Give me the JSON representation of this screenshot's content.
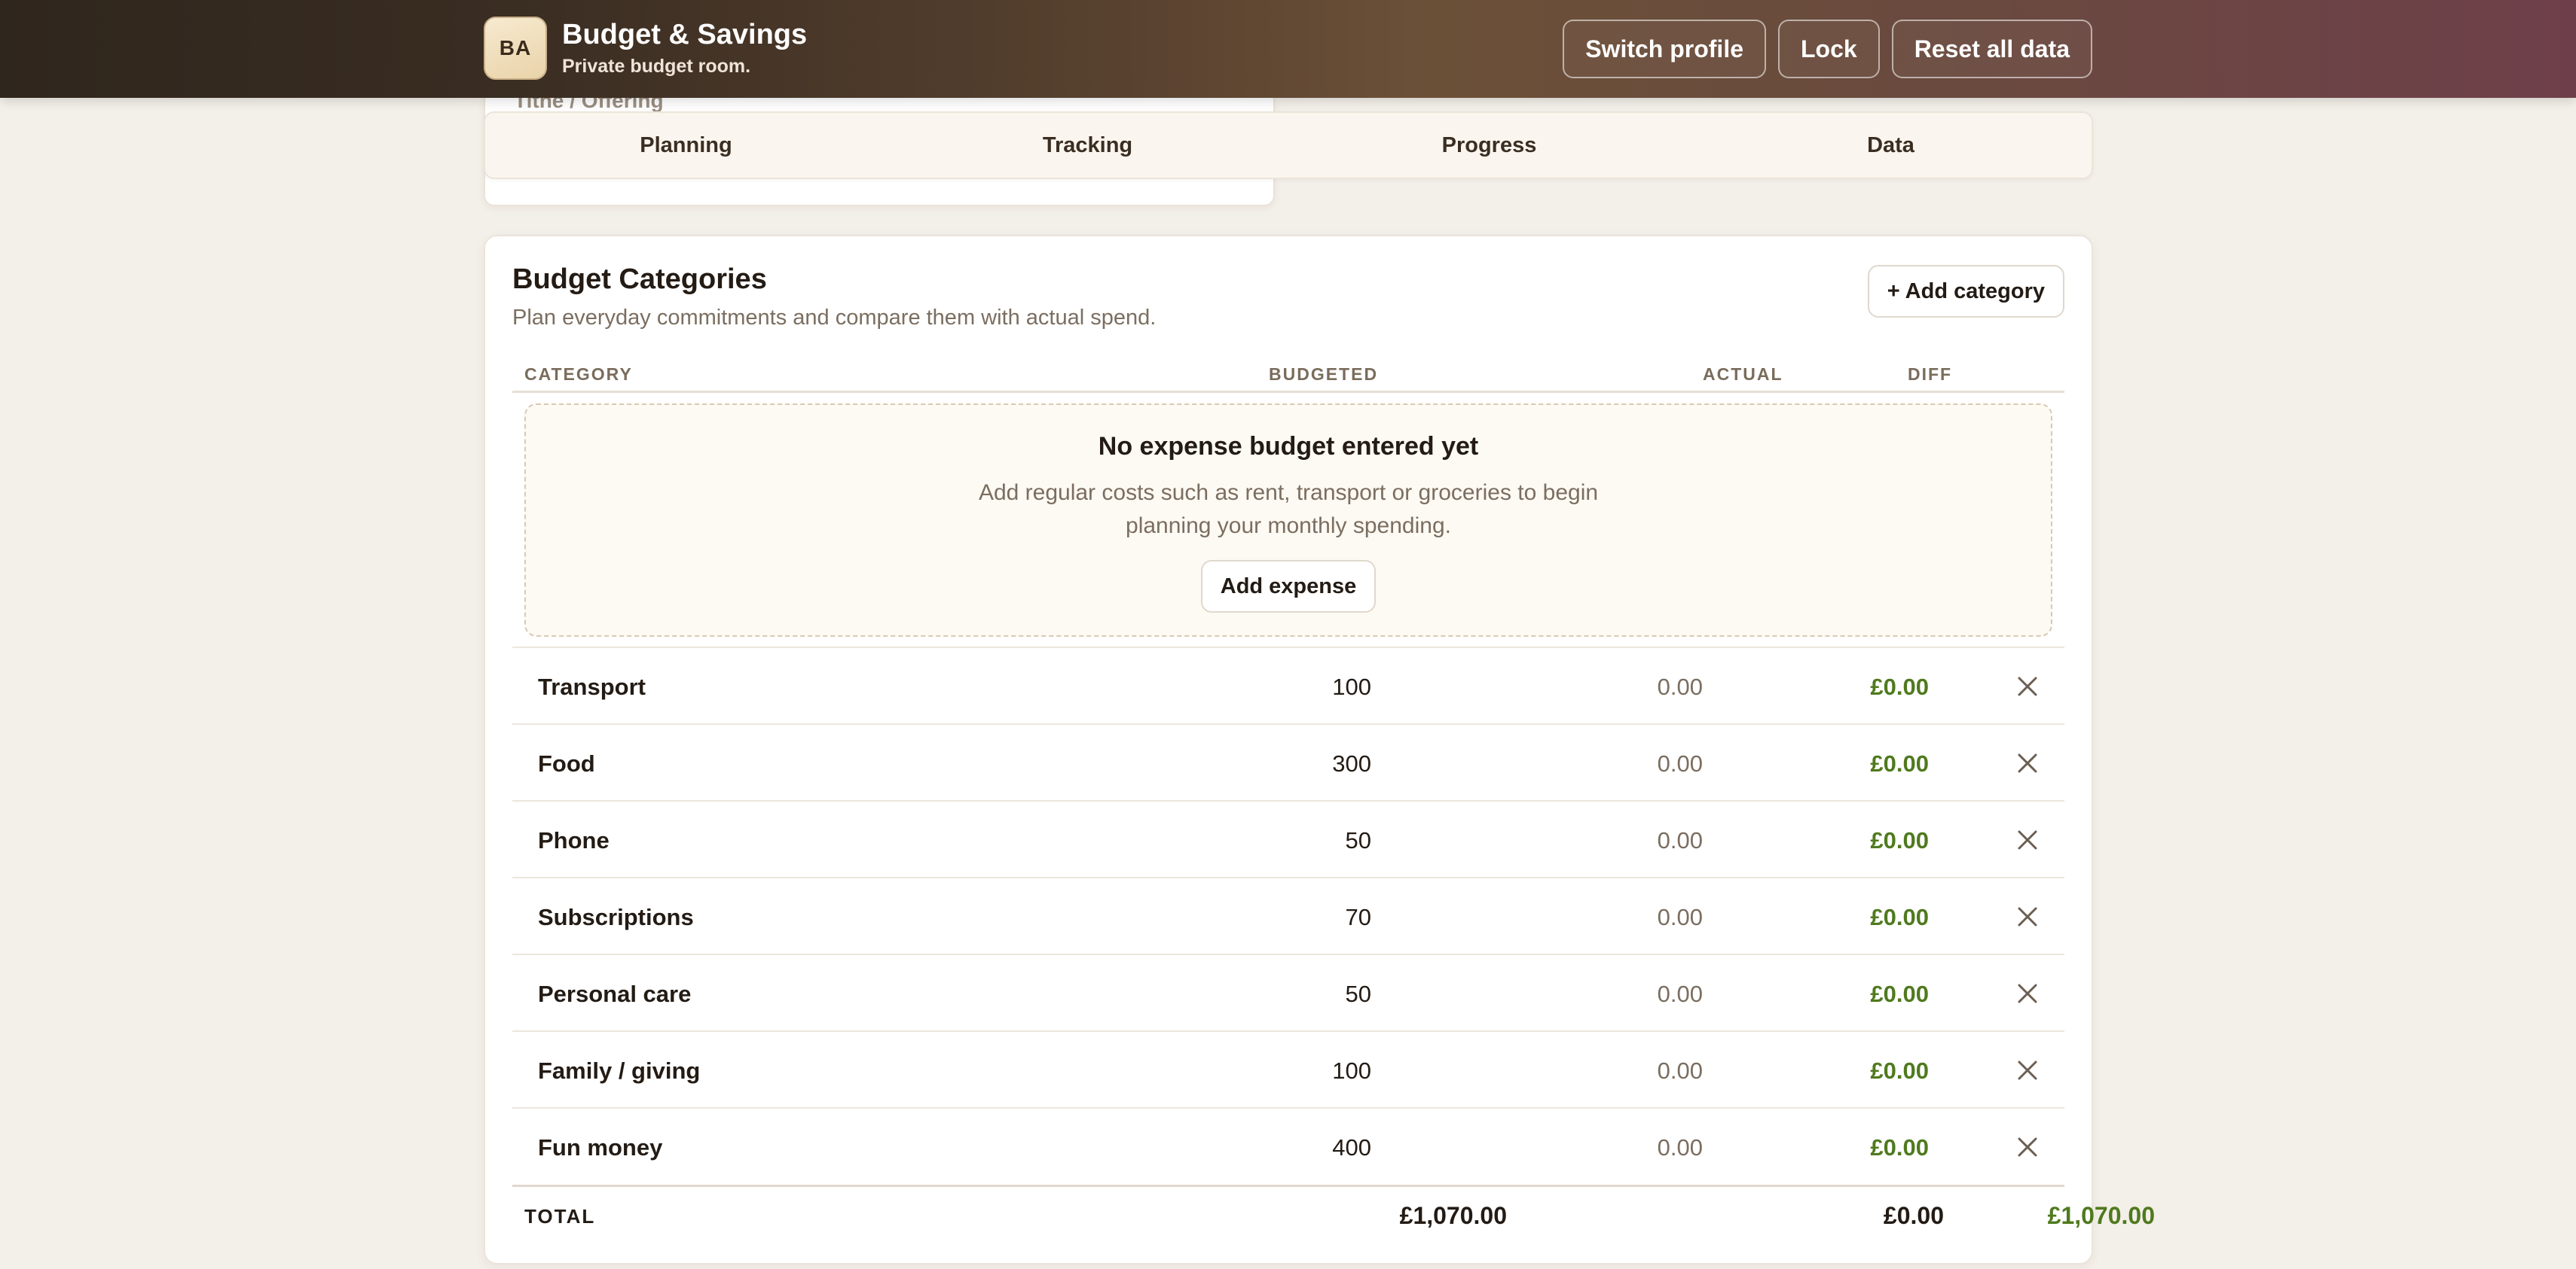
{
  "header": {
    "logo_text": "BA",
    "title": "Budget & Savings",
    "subtitle": "Private budget room.",
    "buttons": {
      "switch_profile": "Switch profile",
      "lock": "Lock",
      "reset": "Reset all data"
    }
  },
  "under_card": {
    "label": "Tithe / Offering"
  },
  "tabs": [
    "Planning",
    "Tracking",
    "Progress",
    "Data"
  ],
  "budget": {
    "title": "Budget Categories",
    "subtitle": "Plan everyday commitments and compare them with actual spend.",
    "add_category_label": "+ Add category",
    "columns": {
      "category": "CATEGORY",
      "budgeted": "BUDGETED",
      "actual": "ACTUAL",
      "diff": "DIFF"
    },
    "empty_state": {
      "title": "No expense budget entered yet",
      "text": "Add regular costs such as rent, transport or groceries to begin planning your monthly spending.",
      "button": "Add expense"
    },
    "rows": [
      {
        "name": "Transport",
        "budgeted": "100",
        "actual": "0.00",
        "diff": "£0.00"
      },
      {
        "name": "Food",
        "budgeted": "300",
        "actual": "0.00",
        "diff": "£0.00"
      },
      {
        "name": "Phone",
        "budgeted": "50",
        "actual": "0.00",
        "diff": "£0.00"
      },
      {
        "name": "Subscriptions",
        "budgeted": "70",
        "actual": "0.00",
        "diff": "£0.00"
      },
      {
        "name": "Personal care",
        "budgeted": "50",
        "actual": "0.00",
        "diff": "£0.00"
      },
      {
        "name": "Family / giving",
        "budgeted": "100",
        "actual": "0.00",
        "diff": "£0.00"
      },
      {
        "name": "Fun money",
        "budgeted": "400",
        "actual": "0.00",
        "diff": "£0.00"
      }
    ],
    "total": {
      "label": "TOTAL",
      "budgeted": "£1,070.00",
      "actual": "£0.00",
      "diff": "£1,070.00"
    },
    "remove_icon": "close-icon",
    "colors": {
      "positive": "#4f7a1e"
    }
  }
}
